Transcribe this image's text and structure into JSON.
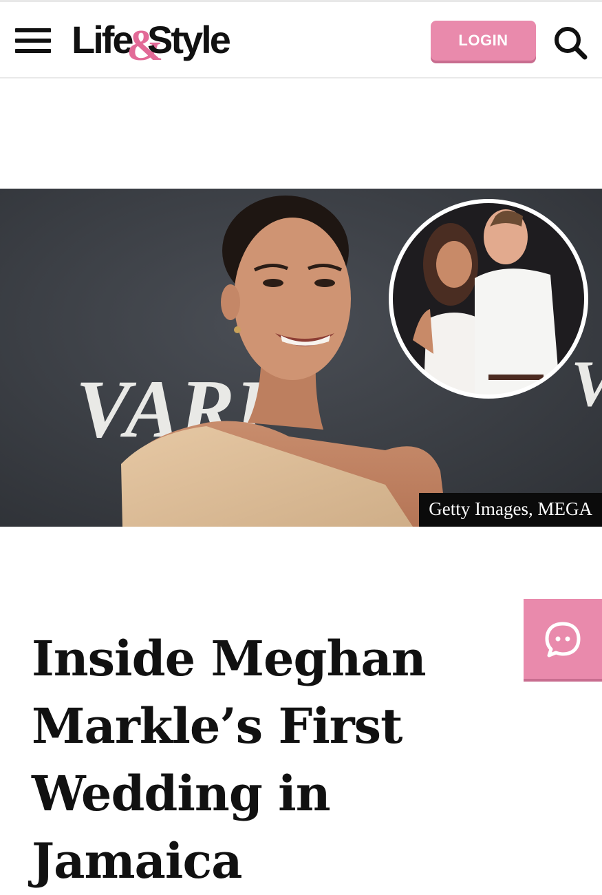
{
  "header": {
    "menu_icon": "hamburger-menu-icon",
    "logo": {
      "part1": "Life",
      "ampersand": "&",
      "part2": "Style",
      "accent": "#e26a97"
    },
    "login_label": "LOGIN",
    "search_icon": "search-icon",
    "button_color": "#e98aac"
  },
  "hero": {
    "image": "Meghan Markle smiling at Variety event in beige one-shoulder dress, inset photo with first husband",
    "backdrop_text_left": "VARI",
    "backdrop_text_right": "V",
    "credit": "Getty Images, MEGA"
  },
  "chat": {
    "icon": "chat-bubble-icon"
  },
  "article": {
    "title": "Inside Meghan Markle’s First Wedding in Jamaica"
  }
}
